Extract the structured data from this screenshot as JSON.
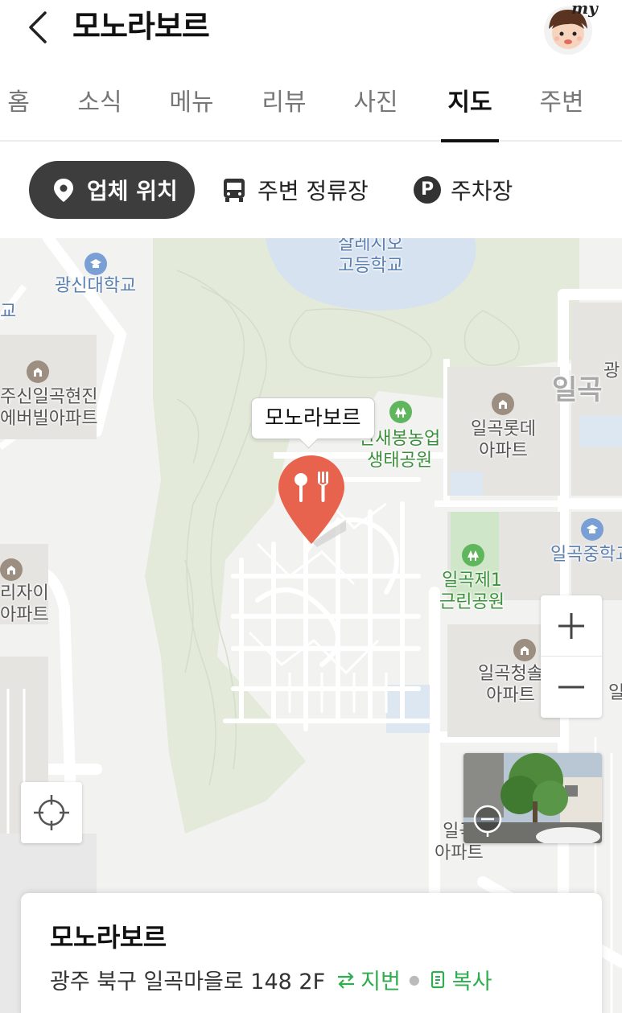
{
  "header": {
    "title": "모노라보르",
    "avatar_badge": "my"
  },
  "tabs": [
    {
      "label": "홈"
    },
    {
      "label": "소식"
    },
    {
      "label": "메뉴"
    },
    {
      "label": "리뷰"
    },
    {
      "label": "사진"
    },
    {
      "label": "지도",
      "active": true
    },
    {
      "label": "주변"
    }
  ],
  "chips": {
    "location": "업체 위치",
    "bus": "주변 정류장",
    "parking": "주차장",
    "parking_letter": "P"
  },
  "map": {
    "labels": {
      "school1": "살레시오",
      "school2": "고등학교",
      "univ": "광신대학교",
      "edge_gyo": "교",
      "apt_a1": "주신일곡현진",
      "apt_a2": "에버빌아파트",
      "eco_park1": "한새봉농업",
      "eco_park2": "생태공원",
      "lotte1": "일곡롯데",
      "lotte2": "아파트",
      "district": "일곡",
      "edge_gwang": "광",
      "middle_school": "일곡중학교",
      "park1": "일곡제1",
      "park2": "근린공원",
      "xi1": "리자이",
      "xi2": "아파트",
      "cheongsol1": "일곡청솔",
      "cheongsol2": "아파트",
      "edge_il": "일",
      "apt_bottom1": "일곡",
      "apt_bottom2": "아파트"
    },
    "callout": "모노라보르",
    "marker_color": "#e8634d"
  },
  "info": {
    "name": "모노라보르",
    "address": "광주 북구 일곡마을로 148 2F",
    "lot_label": "지번",
    "copy_label": "복사"
  },
  "colors": {
    "accent_green": "#2fad4f",
    "active_chip": "#3d3d3d",
    "text": "#111111"
  }
}
